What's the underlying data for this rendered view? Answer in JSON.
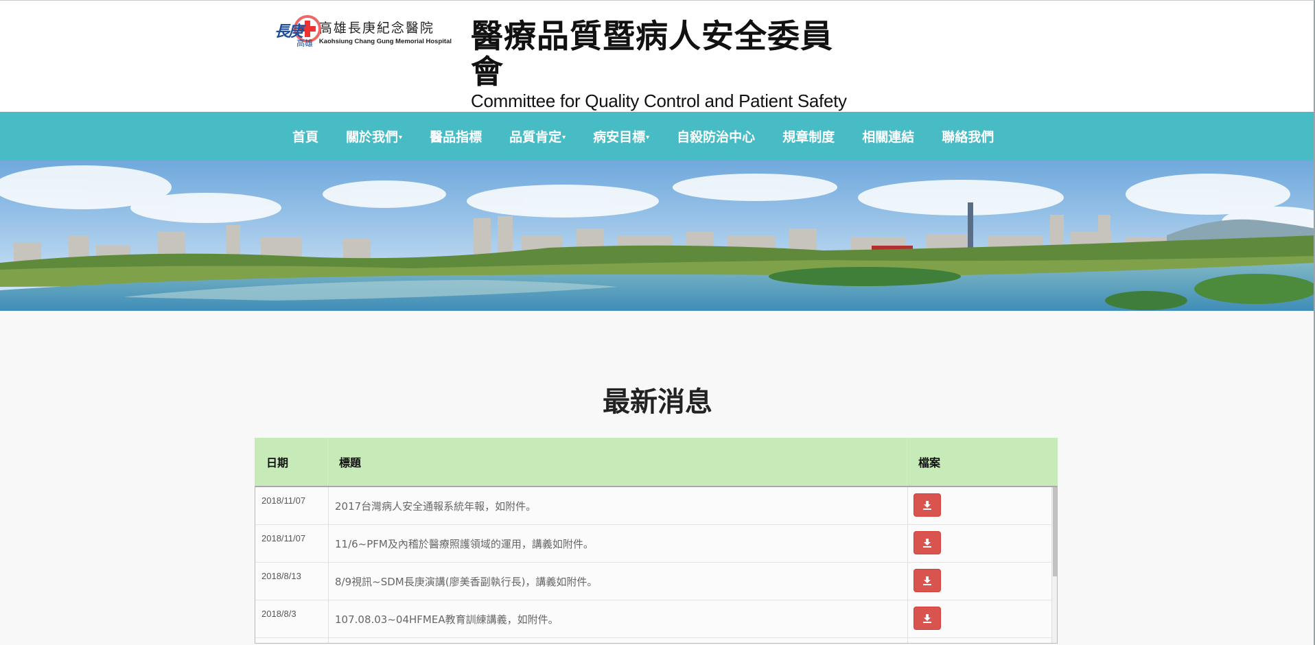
{
  "header": {
    "logo": {
      "mark_text": "長庚",
      "mark_sub": "高雄",
      "name_zh": "高雄長庚紀念醫院",
      "name_en": "Kaohsiung Chang Gung Memorial Hospital"
    },
    "title_zh": "醫療品質暨病人安全委員會",
    "title_en": "Committee for Quality Control and Patient Safety"
  },
  "nav": {
    "items": [
      {
        "label": "首頁",
        "dropdown": false
      },
      {
        "label": "關於我們",
        "dropdown": true
      },
      {
        "label": "醫品指標",
        "dropdown": false
      },
      {
        "label": "品質肯定",
        "dropdown": true
      },
      {
        "label": "病安目標",
        "dropdown": true
      },
      {
        "label": "自殺防治中心",
        "dropdown": false
      },
      {
        "label": "規章制度",
        "dropdown": false
      },
      {
        "label": "相關連結",
        "dropdown": false
      },
      {
        "label": "聯絡我們",
        "dropdown": false
      }
    ]
  },
  "news": {
    "heading": "最新消息",
    "columns": {
      "date": "日期",
      "title": "標題",
      "file": "檔案"
    },
    "rows": [
      {
        "date": "2018/11/07",
        "title": "2017台灣病人安全通報系統年報，如附件。"
      },
      {
        "date": "2018/11/07",
        "title": "11/6~PFM及內稽於醫療照護領域的運用，講義如附件。"
      },
      {
        "date": "2018/8/13",
        "title": "8/9視訊~SDM長庚演講(廖美香副執行長)，講義如附件。"
      },
      {
        "date": "2018/8/3",
        "title": "107.08.03~04HFMEA教育訓練講義，如附件。"
      },
      {
        "date": "",
        "title": ""
      }
    ]
  },
  "colors": {
    "nav_bg": "#47bcc5",
    "table_head_bg": "#c6eab8",
    "download_btn": "#d9534f"
  },
  "icons": {
    "download": "download-icon",
    "caret": "caret-down-icon"
  }
}
